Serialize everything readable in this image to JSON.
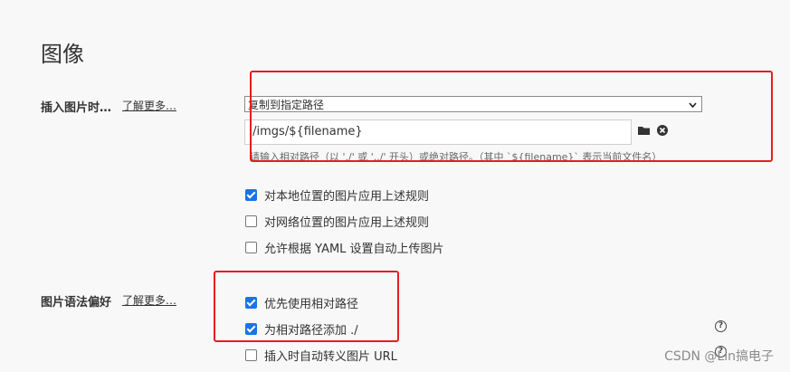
{
  "section": {
    "title": "图像"
  },
  "insert_image": {
    "label": "插入图片时…",
    "learn_more": "了解更多…",
    "select_value": "复制到指定路径",
    "path_value": "./imgs/${filename}",
    "hint": "请输入相对路径（以 './' 或 '../' 开头）或绝对路径。（其中 `${filename}` 表示当前文件名）",
    "icons": [
      "folder-icon",
      "clear-icon"
    ]
  },
  "insert_options": [
    {
      "label": "对本地位置的图片应用上述规则",
      "checked": true
    },
    {
      "label": "对网络位置的图片应用上述规则",
      "checked": false
    },
    {
      "label": "允许根据 YAML 设置自动上传图片",
      "checked": false
    }
  ],
  "syntax_pref": {
    "label": "图片语法偏好",
    "learn_more": "了解更多…",
    "options": [
      {
        "label": "优先使用相对路径",
        "checked": true
      },
      {
        "label": "为相对路径添加 ./",
        "checked": true
      },
      {
        "label": "插入时自动转义图片 URL",
        "checked": false
      }
    ],
    "help_icon": "?"
  },
  "watermark": "CSDN @Lin搞电子",
  "colors": {
    "annotation": "#e02020",
    "checkbox_on": "#1a73e8"
  }
}
